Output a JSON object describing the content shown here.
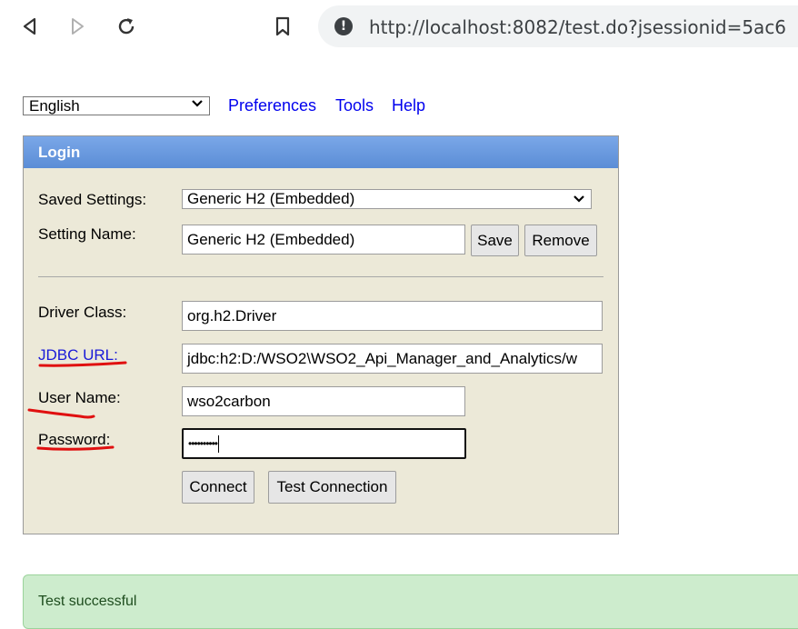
{
  "browser": {
    "url": "http://localhost:8082/test.do?jsessionid=5ac6",
    "icons": [
      "back-icon",
      "forward-icon",
      "reload-icon",
      "bookmark-icon",
      "info-icon"
    ]
  },
  "menu": {
    "language": "English",
    "links": [
      "Preferences",
      "Tools",
      "Help"
    ]
  },
  "login": {
    "title": "Login",
    "saved_settings_label": "Saved Settings:",
    "saved_settings_value": "Generic H2 (Embedded)",
    "setting_name_label": "Setting Name:",
    "setting_name_value": "Generic H2 (Embedded)",
    "save_label": "Save",
    "remove_label": "Remove",
    "driver_class_label": "Driver Class:",
    "driver_class_value": "org.h2.Driver",
    "jdbc_url_label": "JDBC URL:",
    "jdbc_url_value": "jdbc:h2:D:/WSO2\\WSO2_Api_Manager_and_Analytics/w",
    "user_name_label": "User Name:",
    "user_name_value": "wso2carbon",
    "password_label": "Password:",
    "password_value": "••••••••••",
    "connect_label": "Connect",
    "test_connection_label": "Test Connection"
  },
  "result": {
    "message": "Test successful"
  },
  "colors": {
    "header_blue": "#6a9be0",
    "panel_bg": "#ece9d8",
    "link_blue": "#0000ee",
    "success_bg": "#cdeccd",
    "annotation_red": "#e01010"
  }
}
